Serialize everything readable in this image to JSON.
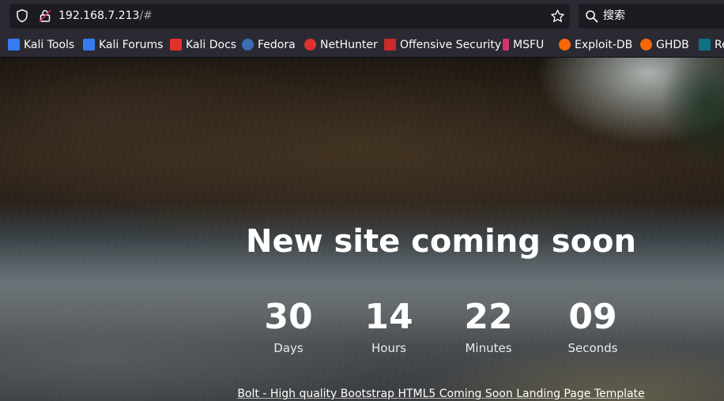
{
  "browser": {
    "url_host": "192.168.7.213",
    "url_path": "/#",
    "search_placeholder": "搜索"
  },
  "bookmarks": [
    {
      "label": "Kali Tools",
      "icon": "kali-dragon-icon",
      "color": "#367bf0"
    },
    {
      "label": "Kali Forums",
      "icon": "kali-dragon-icon",
      "color": "#367bf0"
    },
    {
      "label": "Kali Docs",
      "icon": "kali-docs-icon",
      "color": "#e03131"
    },
    {
      "label": "Fedora",
      "icon": "fedora-icon",
      "color": "#3c6eb4"
    },
    {
      "label": "NetHunter",
      "icon": "nethunter-icon",
      "color": "#e03131"
    },
    {
      "label": "Offensive Security",
      "icon": "offsec-icon",
      "color": "#c92a2a"
    },
    {
      "label": "MSFU",
      "icon": "msfu-icon",
      "color": "#d6336c"
    },
    {
      "label": "Exploit-DB",
      "icon": "exploit-db-icon",
      "color": "#f76707"
    },
    {
      "label": "GHDB",
      "icon": "ghdb-icon",
      "color": "#f76707"
    },
    {
      "label": "Re",
      "icon": "reverse-icon",
      "color": "#20c997"
    }
  ],
  "page": {
    "headline": "New site coming soon",
    "countdown": [
      {
        "value": "30",
        "label": "Days"
      },
      {
        "value": "14",
        "label": "Hours"
      },
      {
        "value": "22",
        "label": "Minutes"
      },
      {
        "value": "09",
        "label": "Seconds"
      }
    ],
    "credit": "Bolt - High quality Bootstrap HTML5 Coming Soon Landing Page Template"
  }
}
